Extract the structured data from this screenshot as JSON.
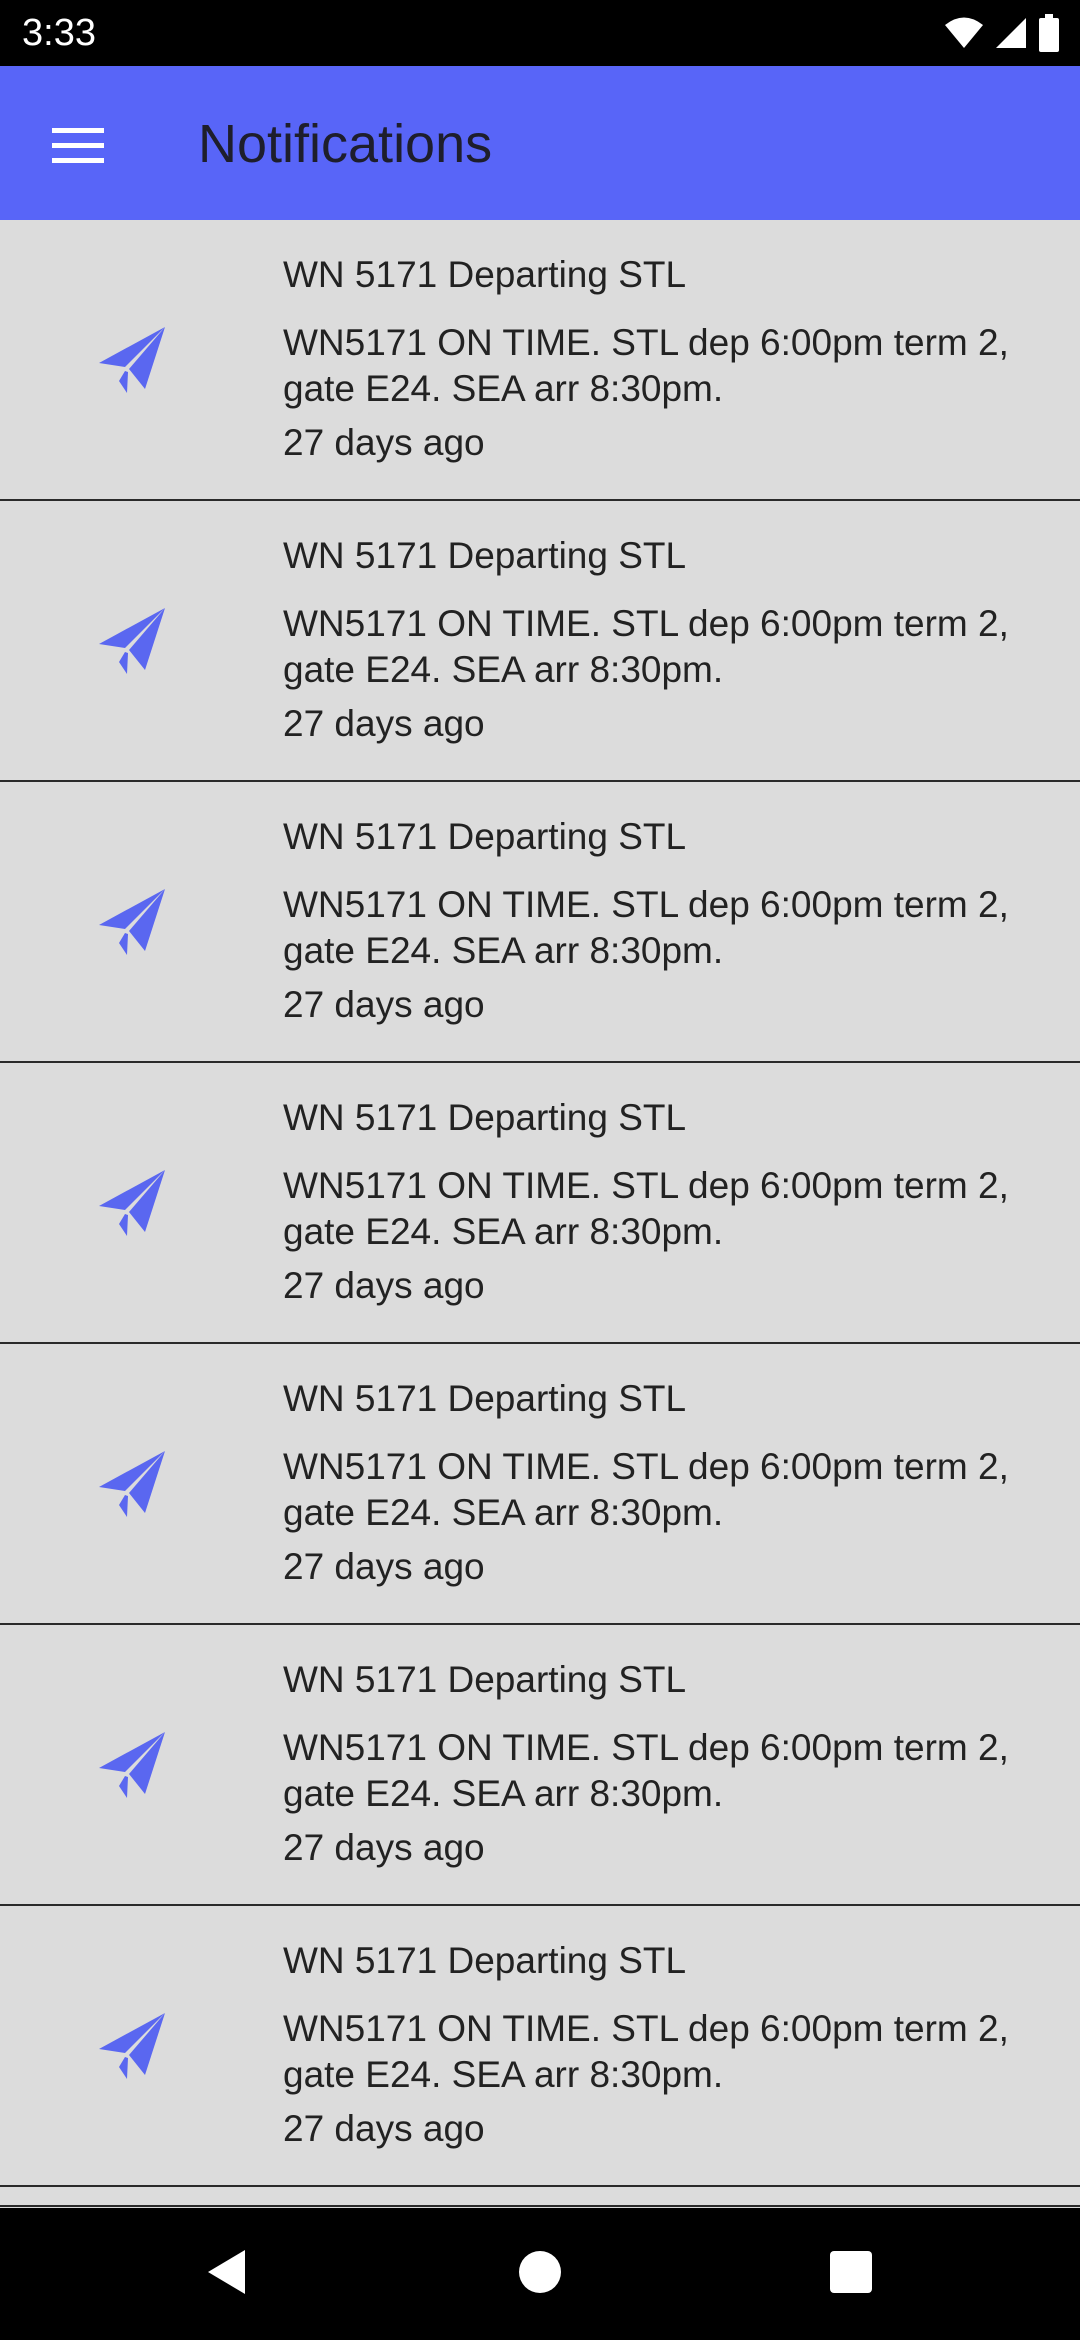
{
  "status_bar": {
    "time": "3:33",
    "icons": [
      "wifi-icon",
      "signal-icon",
      "battery-icon"
    ]
  },
  "app_bar": {
    "title": "Notifications",
    "menu_icon": "hamburger-menu-icon",
    "background_color": "#5865f8"
  },
  "notifications": [
    {
      "icon": "paper-plane-icon",
      "title": "WN 5171 Departing STL",
      "body": "WN5171 ON TIME. STL dep 6:00pm term 2, gate E24. SEA arr 8:30pm.",
      "time": "27 days ago"
    },
    {
      "icon": "paper-plane-icon",
      "title": "WN 5171 Departing STL",
      "body": "WN5171 ON TIME. STL dep 6:00pm term 2, gate E24. SEA arr 8:30pm.",
      "time": "27 days ago"
    },
    {
      "icon": "paper-plane-icon",
      "title": "WN 5171 Departing STL",
      "body": "WN5171 ON TIME. STL dep 6:00pm term 2, gate E24. SEA arr 8:30pm.",
      "time": "27 days ago"
    },
    {
      "icon": "paper-plane-icon",
      "title": "WN 5171 Departing STL",
      "body": "WN5171 ON TIME. STL dep 6:00pm term 2, gate E24. SEA arr 8:30pm.",
      "time": "27 days ago"
    },
    {
      "icon": "paper-plane-icon",
      "title": "WN 5171 Departing STL",
      "body": "WN5171 ON TIME. STL dep 6:00pm term 2, gate E24. SEA arr 8:30pm.",
      "time": "27 days ago"
    },
    {
      "icon": "paper-plane-icon",
      "title": "WN 5171 Departing STL",
      "body": "WN5171 ON TIME. STL dep 6:00pm term 2, gate E24. SEA arr 8:30pm.",
      "time": "27 days ago"
    },
    {
      "icon": "paper-plane-icon",
      "title": "WN 5171 Departing STL",
      "body": "WN5171 ON TIME. STL dep 6:00pm term 2, gate E24. SEA arr 8:30pm.",
      "time": "27 days ago"
    }
  ],
  "colors": {
    "accent": "#5865f8",
    "icon": "#5865f8",
    "list_background": "#dcdcdc",
    "divider": "#2a2a2a"
  },
  "nav_bar": {
    "buttons": [
      "back-icon",
      "home-icon",
      "recents-icon"
    ]
  }
}
